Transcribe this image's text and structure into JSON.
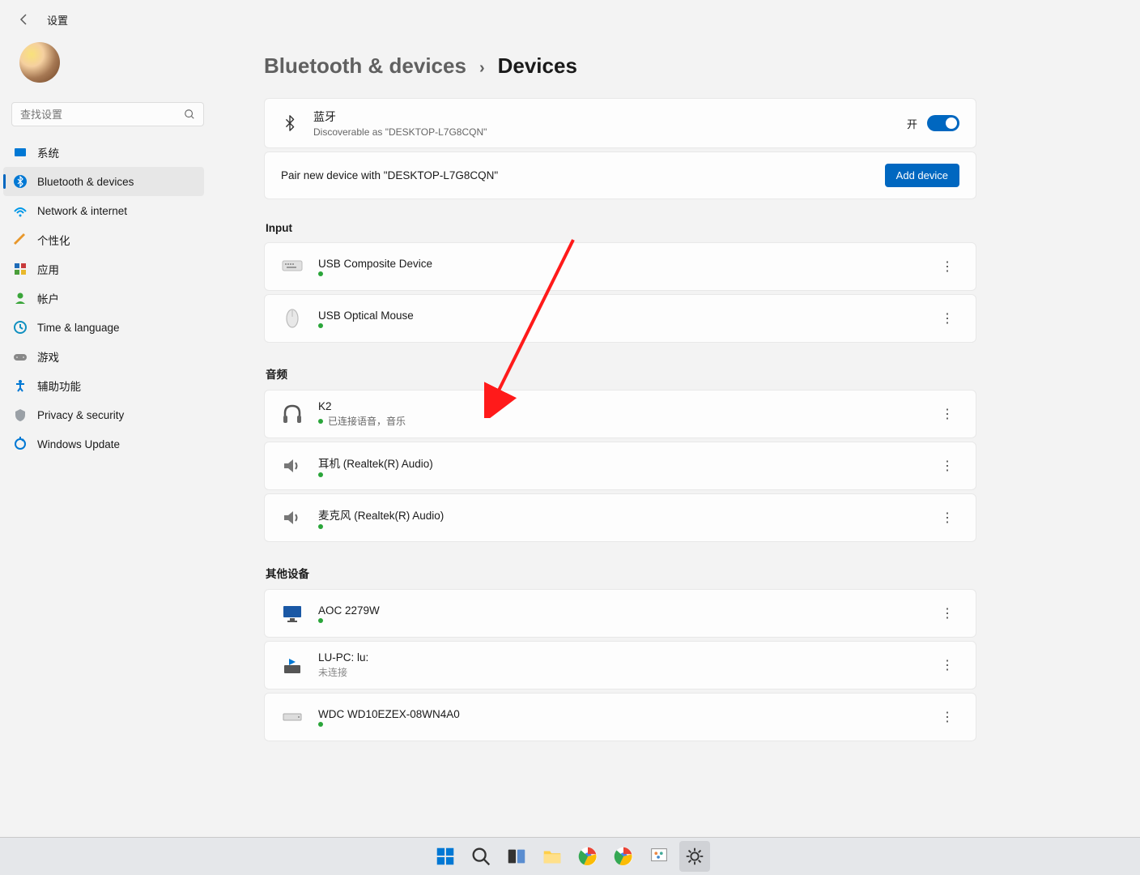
{
  "header": {
    "title": "设置"
  },
  "search": {
    "placeholder": "查找设置"
  },
  "sidebar": {
    "items": [
      {
        "label": "系统",
        "icon": "system"
      },
      {
        "label": "Bluetooth & devices",
        "icon": "bluetooth",
        "active": true
      },
      {
        "label": "Network & internet",
        "icon": "wifi"
      },
      {
        "label": "个性化",
        "icon": "personalize"
      },
      {
        "label": "应用",
        "icon": "apps"
      },
      {
        "label": "帐户",
        "icon": "account"
      },
      {
        "label": "Time & language",
        "icon": "time"
      },
      {
        "label": "游戏",
        "icon": "gaming"
      },
      {
        "label": "辅助功能",
        "icon": "accessibility"
      },
      {
        "label": "Privacy & security",
        "icon": "privacy"
      },
      {
        "label": "Windows Update",
        "icon": "update"
      }
    ]
  },
  "breadcrumb": {
    "parent": "Bluetooth & devices",
    "current": "Devices"
  },
  "bluetooth_card": {
    "title": "蓝牙",
    "subtitle": "Discoverable as \"DESKTOP-L7G8CQN\"",
    "toggle_label": "开",
    "toggle_on": true
  },
  "pair_card": {
    "text": "Pair new device with \"DESKTOP-L7G8CQN\"",
    "button": "Add device"
  },
  "sections": [
    {
      "title": "Input",
      "devices": [
        {
          "name": "USB Composite Device",
          "icon": "keyboard",
          "status_type": "dot"
        },
        {
          "name": "USB Optical Mouse",
          "icon": "mouse",
          "status_type": "dot"
        }
      ]
    },
    {
      "title": "音频",
      "devices": [
        {
          "name": "K2",
          "icon": "headphones",
          "status_type": "dot_text",
          "status_text": "已连接语音，音乐"
        },
        {
          "name": "耳机 (Realtek(R) Audio)",
          "icon": "speaker",
          "status_type": "dot"
        },
        {
          "name": "麦克风 (Realtek(R) Audio)",
          "icon": "speaker",
          "status_type": "dot"
        }
      ]
    },
    {
      "title": "其他设备",
      "devices": [
        {
          "name": "AOC 2279W",
          "icon": "monitor",
          "status_type": "dot"
        },
        {
          "name": "LU-PC: lu:",
          "icon": "media-pc",
          "status_type": "text",
          "status_text": "未连接"
        },
        {
          "name": "WDC WD10EZEX-08WN4A0",
          "icon": "disk",
          "status_type": "dot"
        }
      ]
    }
  ],
  "taskbar": {
    "items": [
      "start",
      "search",
      "taskview",
      "explorer",
      "chrome1",
      "chrome2",
      "paint",
      "settings"
    ]
  }
}
